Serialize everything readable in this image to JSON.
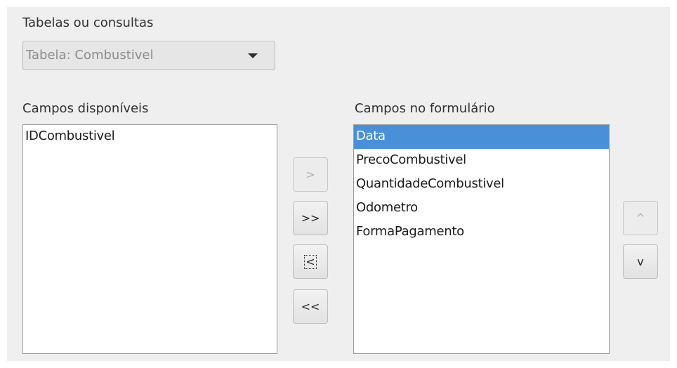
{
  "source_section": {
    "label": "Tabelas ou consultas",
    "selected_value": "Tabela: Combustivel"
  },
  "available_fields": {
    "label": "Campos disponíveis",
    "items": [
      "IDCombustivel"
    ]
  },
  "form_fields": {
    "label": "Campos no formulário",
    "items": [
      "Data",
      "PrecoCombustivel",
      "QuantidadeCombustivel",
      "Odometro",
      "FormaPagamento"
    ],
    "selected_index": 0
  },
  "transfer_buttons": {
    "add_one": ">",
    "add_all": ">>",
    "remove_one": "<",
    "remove_all": "<<"
  },
  "order_buttons": {
    "move_up": "^",
    "move_down": "v"
  }
}
